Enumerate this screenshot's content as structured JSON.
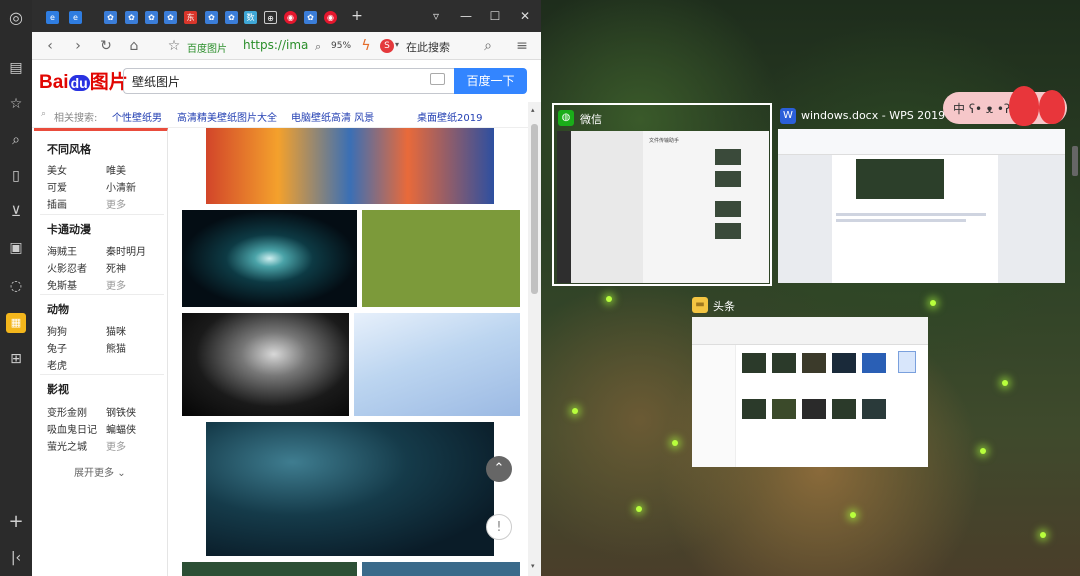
{
  "browser": {
    "address": {
      "site_name": "百度图片",
      "url": "https://ima",
      "zoom": "95%",
      "search_placeholder": "在此搜索"
    },
    "search": {
      "logo_text": "Bai",
      "logo_du": "du",
      "logo_pic": "图片",
      "query": "壁纸图片",
      "button": "百度一下"
    },
    "related": {
      "label": "相关搜索:",
      "links": [
        "个性壁纸男",
        "高清精美壁纸图片大全",
        "电脑壁纸高清 风景",
        "桌面壁纸2019"
      ]
    },
    "filters": {
      "categories": [
        {
          "title": "不同风格",
          "items": [
            "美女",
            "唯美",
            "可爱",
            "小清新",
            "插画",
            "更多"
          ]
        },
        {
          "title": "卡通动漫",
          "items": [
            "海贼王",
            "秦时明月",
            "火影忍者",
            "死神",
            "免斯基",
            "更多"
          ]
        },
        {
          "title": "动物",
          "items": [
            "狗狗",
            "猫咪",
            "兔子",
            "熊猫",
            "老虎"
          ]
        },
        {
          "title": "影视",
          "items": [
            "变形金刚",
            "钢铁侠",
            "吸血鬼日记",
            "蝙蝠侠",
            "萤光之城",
            "更多"
          ]
        }
      ],
      "expand": "展开更多"
    }
  },
  "windows": {
    "wechat": {
      "title": "微信",
      "chat_title": "文件传输助手"
    },
    "wps": {
      "title": "windows.docx - WPS 2019"
    },
    "explorer": {
      "title": "头条"
    }
  },
  "widget": {
    "text": "中 ʕ• ᴥ •ʔ"
  },
  "colors": {
    "accent": "#3385ff",
    "link": "#2440b3",
    "red": "#e94c3c",
    "sidebar_active": "#f3b61c"
  }
}
